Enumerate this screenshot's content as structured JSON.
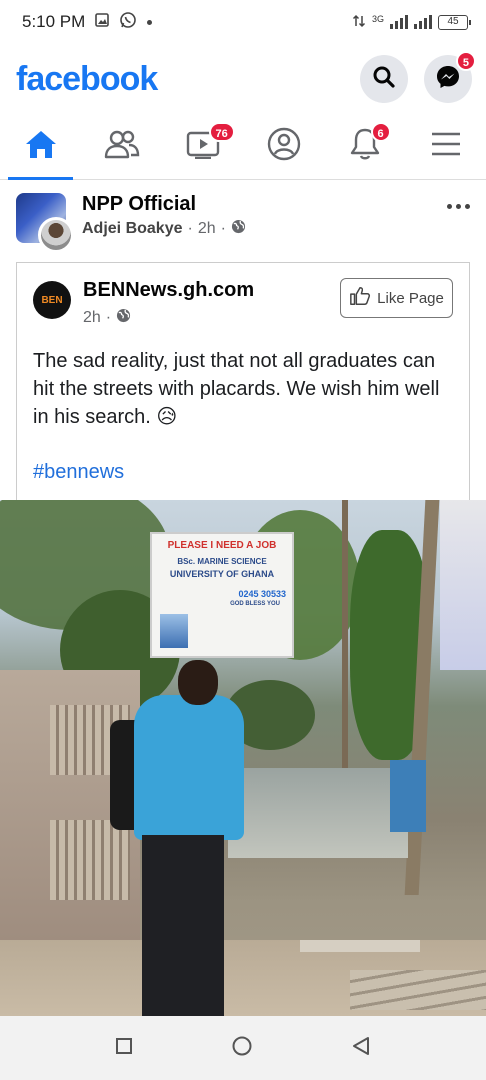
{
  "status_bar": {
    "time": "5:10 PM",
    "network": "3G",
    "battery": "45"
  },
  "header": {
    "logo": "facebook",
    "messenger_badge": "5"
  },
  "tabs": {
    "watch_badge": "76",
    "notifications_badge": "6"
  },
  "post": {
    "page_name": "NPP Official",
    "author": "Adjei Boakye",
    "time": "2h",
    "separator": "·"
  },
  "shared": {
    "page_name": "BENNews.gh.com",
    "time": "2h",
    "separator": "·",
    "logo_text": "BEN",
    "like_label": "Like Page",
    "text": "The sad reality, just that not all graduates can hit the streets with placards. We wish him well in his search. 😥",
    "hashtag": "#bennews"
  },
  "photo": {
    "sign_line1": "PLEASE I NEED A JOB",
    "sign_line2": "BSc. MARINE SCIENCE",
    "sign_line3": "UNIVERSITY OF GHANA",
    "sign_phone": "0245 30533",
    "sign_thanks": "GOD BLESS YOU"
  },
  "colors": {
    "brand": "#1877f2",
    "badge": "#e41e3f",
    "hashtag": "#216fdb"
  },
  "icons": [
    "home-icon",
    "friends-icon",
    "watch-icon",
    "profile-icon",
    "bell-icon",
    "menu-icon",
    "search-icon",
    "messenger-icon",
    "globe-icon",
    "thumbs-up-icon"
  ]
}
